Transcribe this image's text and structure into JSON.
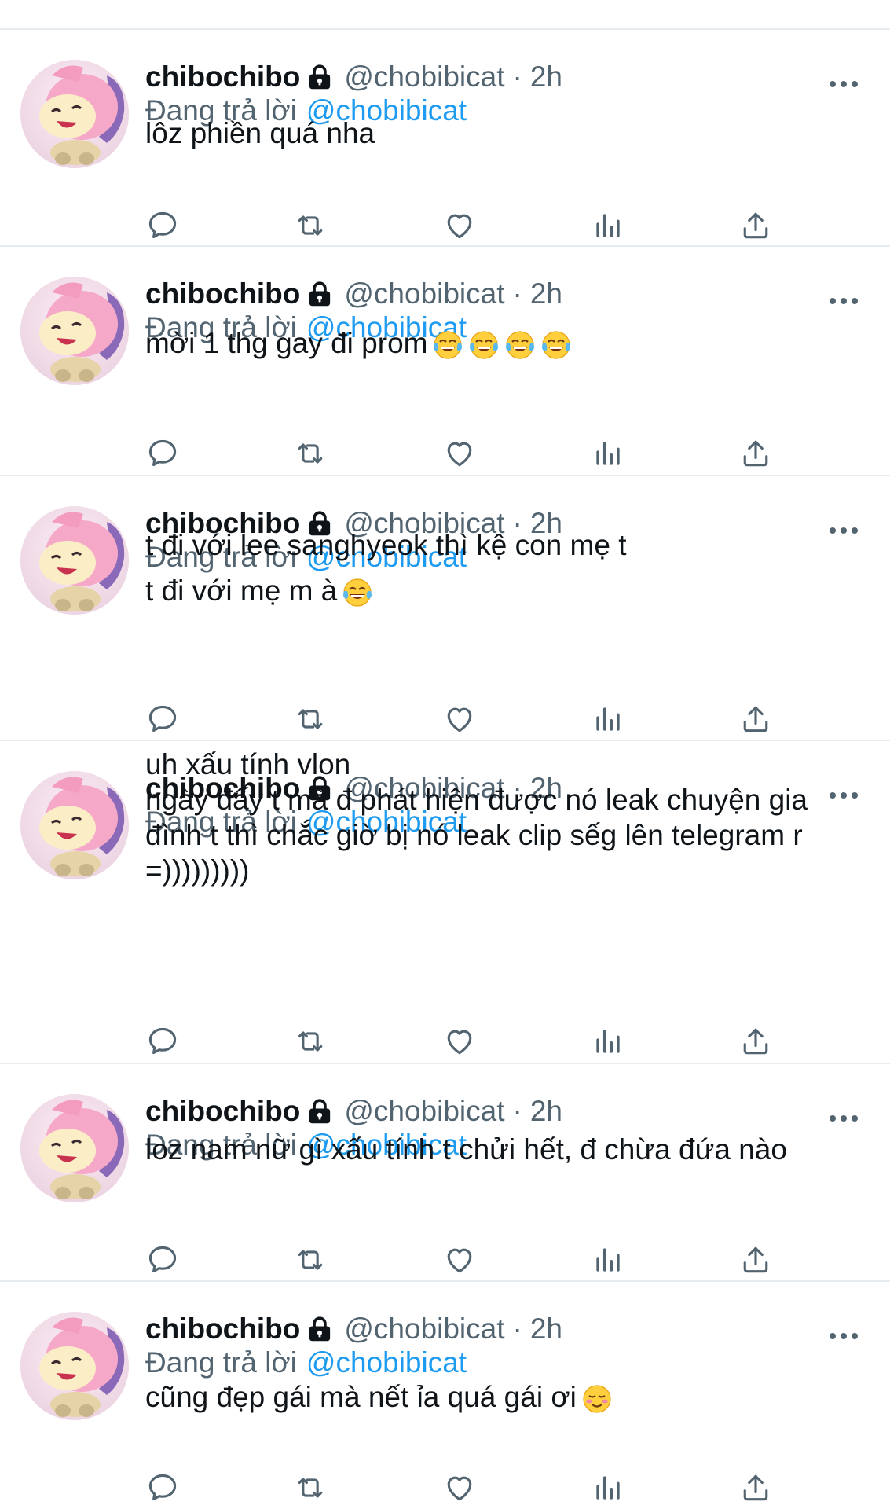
{
  "colors": {
    "text": "#0f1419",
    "muted": "#536471",
    "link": "#1d9bf0",
    "divider": "#e6ecf0"
  },
  "icons": [
    "comment-icon",
    "retweet-icon",
    "heart-icon",
    "analytics-icon",
    "share-icon",
    "lock-icon",
    "more-icon"
  ],
  "tweets": [
    {
      "display_name": "chibochibo",
      "handle": "@chobibicat",
      "separator": "·",
      "time": "2h",
      "reply_label": "Đang trả lời",
      "reply_to": "@chobibicat",
      "lines": [
        "lôz phiền quá nha"
      ],
      "emojis": []
    },
    {
      "display_name": "chibochibo",
      "handle": "@chobibicat",
      "separator": "·",
      "time": "2h",
      "reply_label": "Đang trả lời",
      "reply_to": "@chobibicat",
      "lines": [
        "mời 1 thg gay đi prom"
      ],
      "emojis": [
        "laughing-tears-emoji",
        "laughing-tears-emoji",
        "laughing-tears-emoji",
        "laughing-tears-emoji"
      ]
    },
    {
      "display_name": "chibochibo",
      "handle": "@chobibicat",
      "separator": "·",
      "time": "2h",
      "reply_label": "Đang trả lời",
      "reply_to": "@chobibicat",
      "lines": [
        "t đi với lee sanghyeok thì kệ con mẹ t",
        "t đi với mẹ m à"
      ],
      "emojis": [
        "laughing-tears-emoji"
      ]
    },
    {
      "display_name": "chibochibo",
      "handle": "@chobibicat",
      "separator": "·",
      "time": "2h",
      "reply_label": "Đang trả lời",
      "reply_to": "@chobibicat",
      "lines": [
        "uh xấu tính vlon",
        "ngày đấy t mà đ phát hiện được nó leak chuyện gia",
        "đình t thì chắc giờ bị nó leak clip sếg lên telegram r",
        "=)))))))))"
      ],
      "emojis": []
    },
    {
      "display_name": "chibochibo",
      "handle": "@chobibicat",
      "separator": "·",
      "time": "2h",
      "reply_label": "Đang trả lời",
      "reply_to": "@chobibicat",
      "lines": [
        "loz nam nữ gì xấu tính t chửi hết, đ chừa đứa nào"
      ],
      "emojis": []
    },
    {
      "display_name": "chibochibo",
      "handle": "@chobibicat",
      "separator": "·",
      "time": "2h",
      "reply_label": "Đang trả lời",
      "reply_to": "@chobibicat",
      "lines": [
        "cũng đẹp gái mà nết ỉa quá gái ơi"
      ],
      "emojis": [
        "smiling-blush-emoji"
      ]
    }
  ]
}
